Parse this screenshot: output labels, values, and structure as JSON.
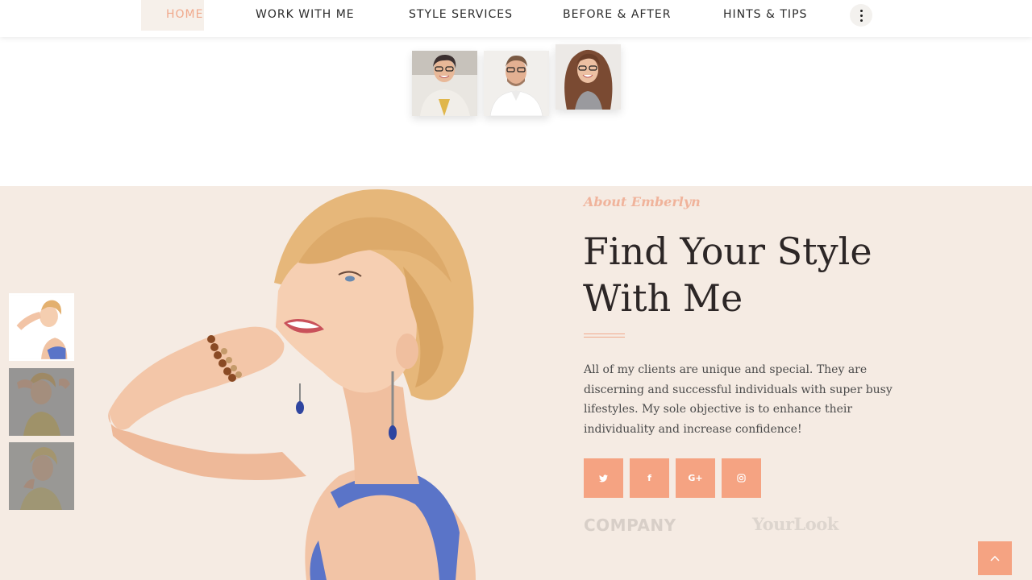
{
  "nav": {
    "items": [
      {
        "label": "HOME",
        "active": true
      },
      {
        "label": "WORK WITH ME"
      },
      {
        "label": "STYLE SERVICES"
      },
      {
        "label": "BEFORE & AFTER"
      },
      {
        "label": "HINTS & TIPS"
      }
    ],
    "more_icon": "vertical-dots-icon"
  },
  "testimonial_thumbs": [
    "woman-glasses-photo",
    "man-glasses-photo",
    "curly-hair-woman-photo"
  ],
  "about": {
    "kicker": "About Emberlyn",
    "headline_line1": "Find Your Style",
    "headline_line2": "With Me",
    "body": "All of my clients are unique and special. They are discerning and successful individuals with super busy lifestyles. My sole objective is to enhance their individuality and increase confidence!",
    "social": [
      {
        "icon": "twitter-icon",
        "glyph": "🐦"
      },
      {
        "icon": "facebook-icon",
        "glyph": "f"
      },
      {
        "icon": "google-plus-icon",
        "glyph": "G+"
      },
      {
        "icon": "instagram-icon",
        "glyph": "◎"
      }
    ],
    "logos": [
      "COMPANY",
      "YourLook"
    ],
    "slide_thumbs": [
      "slide-1",
      "slide-2",
      "slide-3"
    ]
  },
  "colors": {
    "accent": "#f5a382",
    "section_bg": "#f5ebe3",
    "heading": "#2c2626"
  },
  "back_to_top_icon": "chevron-up-icon"
}
